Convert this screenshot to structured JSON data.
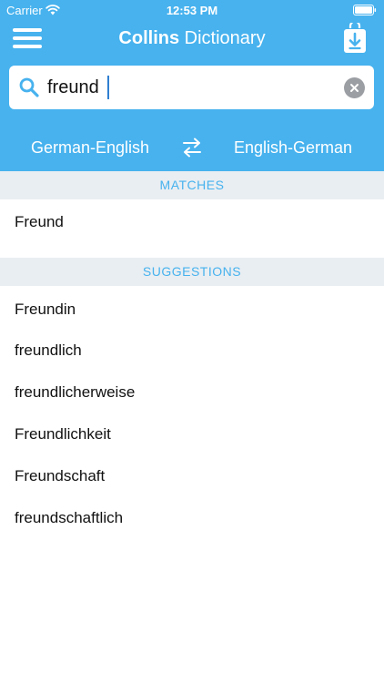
{
  "status_bar": {
    "carrier": "Carrier",
    "time": "12:53 PM"
  },
  "navbar": {
    "title_brand": "Collins",
    "title_rest": " Dictionary",
    "icons": [
      "menu-icon",
      "download-icon"
    ]
  },
  "search": {
    "value": "freund",
    "placeholder": ""
  },
  "languages": {
    "left": "German-English",
    "right": "English-German",
    "swap_icon": "swap-arrows-icon"
  },
  "matches": {
    "header": "MATCHES",
    "items": [
      "Freund"
    ]
  },
  "suggestions": {
    "header": "SUGGESTIONS",
    "items": [
      "Freundin",
      "freundlich",
      "freundlicherweise",
      "Freundlichkeit",
      "Freundschaft",
      "freundschaftlich"
    ]
  },
  "colors": {
    "accent": "#47b2ee",
    "section_bg": "#e9eef2",
    "clear_button": "#9b9ea3"
  }
}
